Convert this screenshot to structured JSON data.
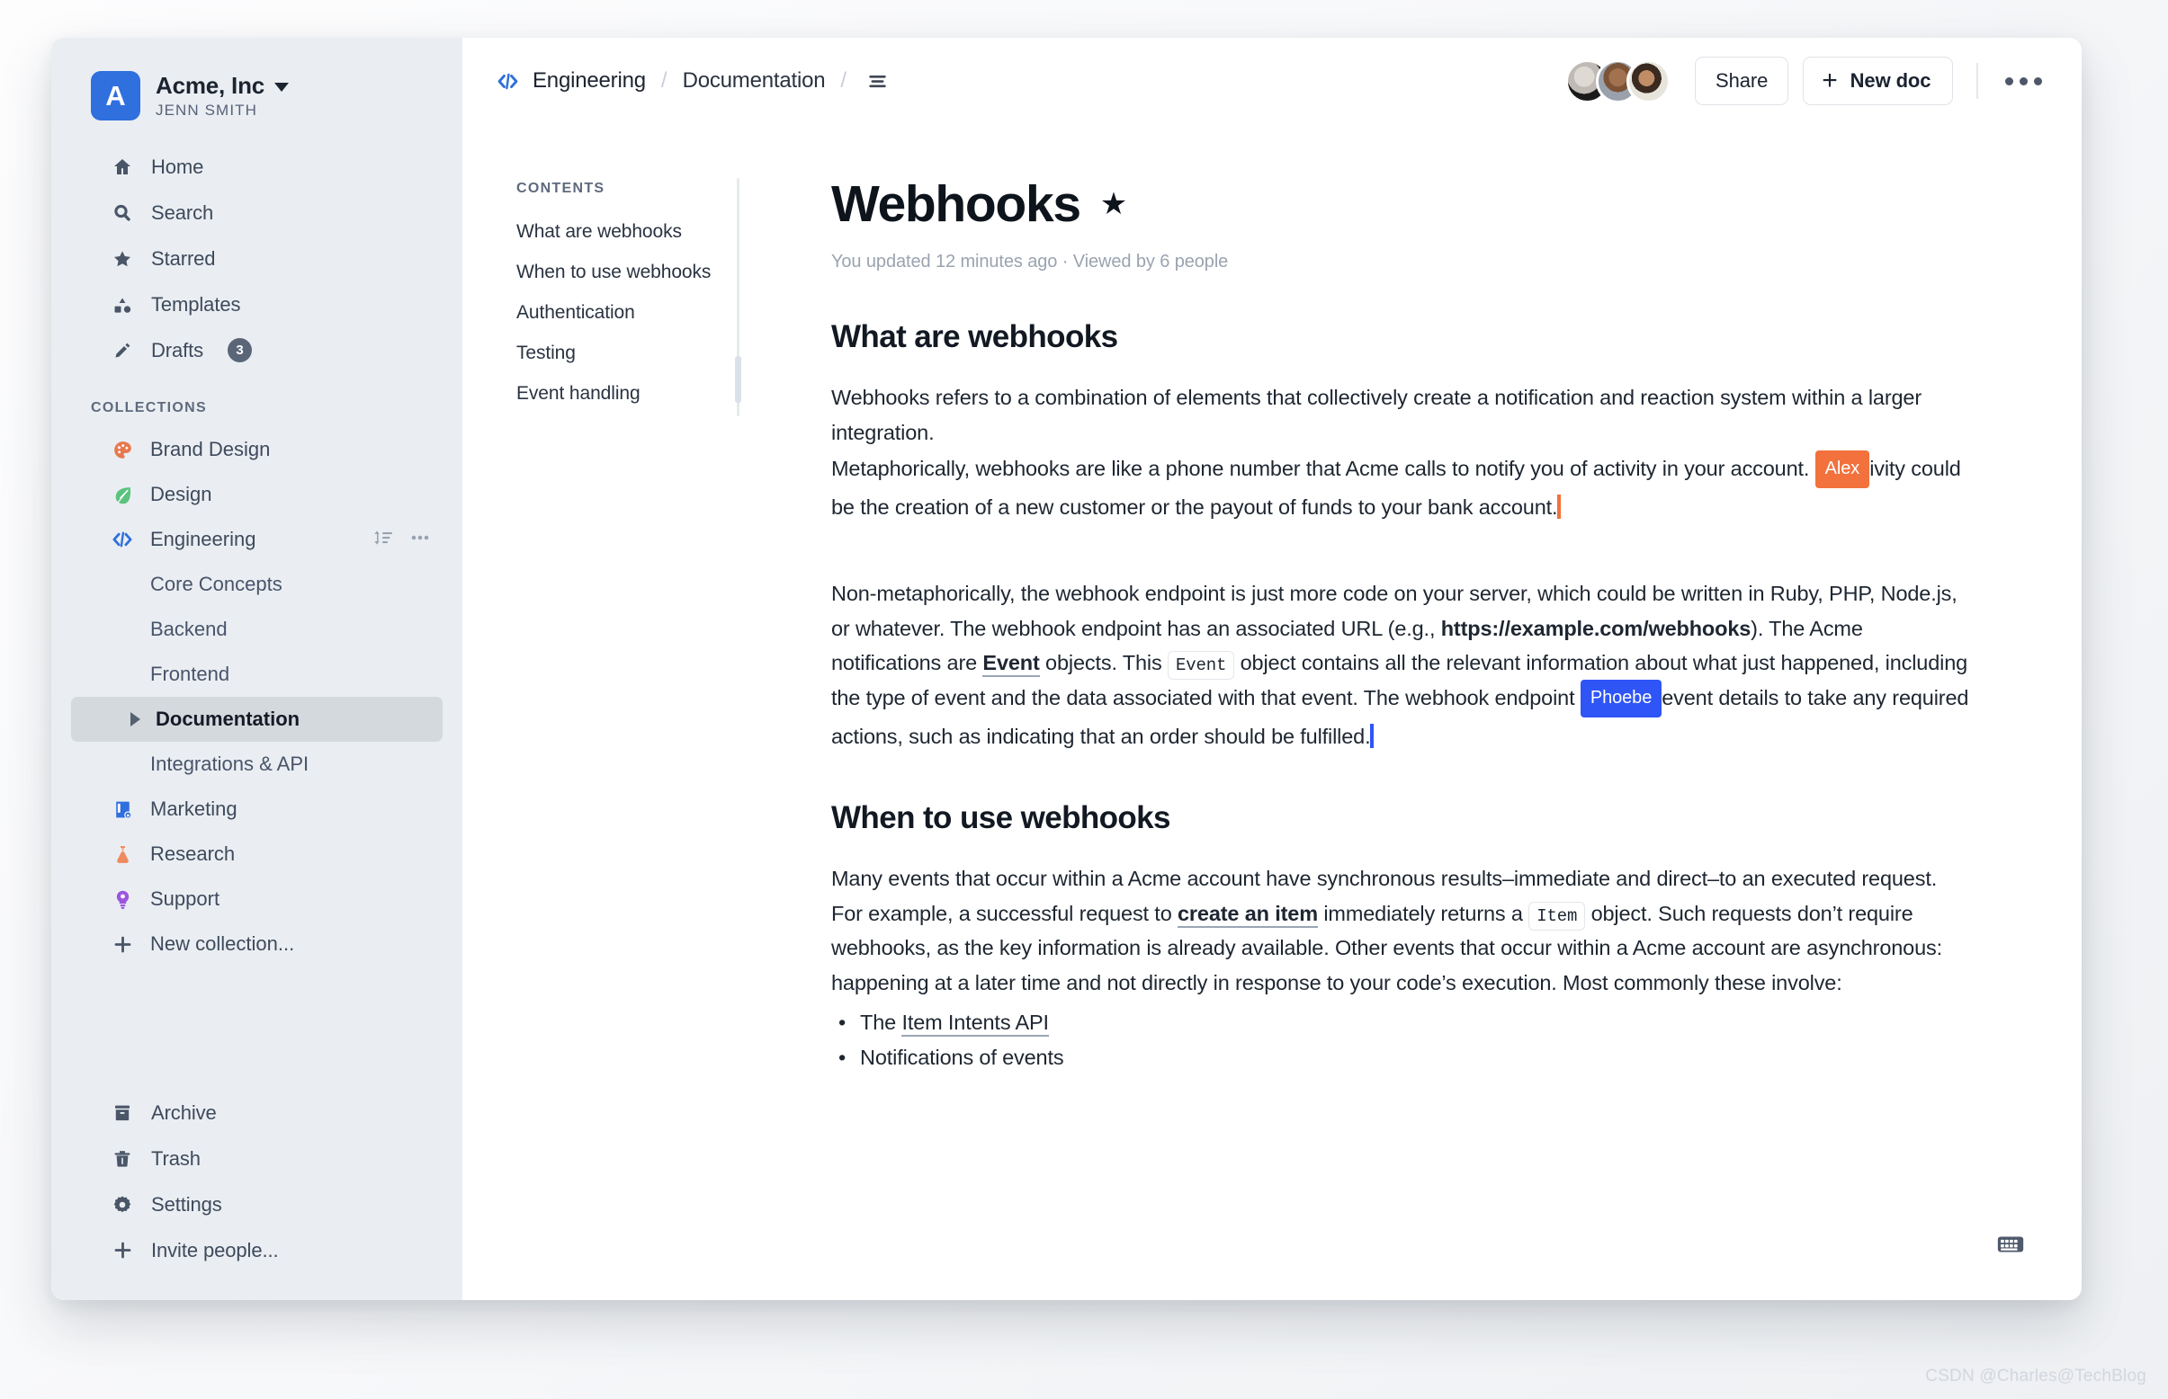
{
  "window": {
    "sidebar": {
      "team": {
        "avatar_letter": "A",
        "name": "Acme, Inc",
        "user": "JENN SMITH",
        "caret_icon": "chevron-down-icon"
      },
      "nav": [
        {
          "label": "Home",
          "icon": "home-icon"
        },
        {
          "label": "Search",
          "icon": "search-icon"
        },
        {
          "label": "Starred",
          "icon": "star-icon"
        },
        {
          "label": "Templates",
          "icon": "templates-icon"
        },
        {
          "label": "Drafts",
          "icon": "pencil-icon",
          "badge": "3"
        }
      ],
      "collections_header": "COLLECTIONS",
      "collections": [
        {
          "label": "Brand Design",
          "icon": "palette-icon",
          "color": "#e8784d"
        },
        {
          "label": "Design",
          "icon": "leaf-icon",
          "color": "#5ac37d"
        },
        {
          "label": "Engineering",
          "icon": "code-icon",
          "color": "#2f6fde",
          "actions": [
            "sort-icon",
            "more-icon"
          ]
        }
      ],
      "engineering_children": [
        {
          "label": "Core Concepts",
          "active": false
        },
        {
          "label": "Backend",
          "active": false
        },
        {
          "label": "Frontend",
          "active": false
        },
        {
          "label": "Documentation",
          "active": true
        },
        {
          "label": "Integrations & API",
          "active": false
        }
      ],
      "collections_after": [
        {
          "label": "Marketing",
          "icon": "book-lock-icon",
          "color": "#2f6fde"
        },
        {
          "label": "Research",
          "icon": "flask-icon",
          "color": "#ef8a5f"
        },
        {
          "label": "Support",
          "icon": "lightbulb-icon",
          "color": "#9b55e0"
        }
      ],
      "new_collection": {
        "label": "New collection...",
        "icon": "plus-icon"
      },
      "bottom": [
        {
          "label": "Archive",
          "icon": "archive-icon"
        },
        {
          "label": "Trash",
          "icon": "trash-icon"
        },
        {
          "label": "Settings",
          "icon": "gear-icon"
        },
        {
          "label": "Invite people...",
          "icon": "plus-icon"
        }
      ]
    },
    "topbar": {
      "breadcrumb": {
        "collection_icon": "code-icon",
        "collection": "Engineering",
        "sep1": "/",
        "document": "Documentation",
        "sep2": "/",
        "menu_icon": "hamburger-icon"
      },
      "share_label": "Share",
      "new_doc_label": "New doc",
      "new_doc_icon": "plus-icon",
      "more_icon": "more-icon",
      "avatar_count": 3
    },
    "toc": {
      "title": "CONTENTS",
      "items": [
        "What are webhooks",
        "When to use webhooks",
        "Authentication",
        "Testing",
        "Event handling"
      ]
    },
    "doc": {
      "title": "Webhooks",
      "star_icon": "star-icon",
      "meta": "You updated 12 minutes ago · Viewed by 6 people",
      "section1": {
        "heading": "What are webhooks",
        "p1": "Webhooks refers to a combination of elements that collectively create a notification and reaction system within a larger integration.",
        "p2_a": "Metaphorically, webhooks are like a phone number that Acme calls to notify you of activity in your account.",
        "p2_cursor": "Alex",
        "p2_b": "ivity could be the creation of a new customer or the payout of funds to your bank account.",
        "p3_a": "Non-metaphorically, the webhook endpoint is just more code on your server, which could be written in Ruby, PHP, Node.js, or whatever. The webhook endpoint has an associated URL (e.g., ",
        "p3_url": "https://example.com/webhooks",
        "p3_b": "). The Acme notifications are ",
        "p3_link": "Event",
        "p3_c": " objects. This ",
        "p3_code": "Event",
        "p3_d": " object contains all the relevant information about what just happened, including the type of event and the data associated with that event. The webhook endpoint ",
        "p3_cursor": "Phoebe",
        "p3_e": "event details to take any required actions, such as indicating that an order should be fulfilled."
      },
      "section2": {
        "heading": "When to use webhooks",
        "p1_a": "Many events that occur within a Acme account have synchronous results–immediate and direct–to an executed request. For example, a successful request to ",
        "p1_link": "create an item",
        "p1_b": " immediately returns a ",
        "p1_code": "Item",
        "p1_c": " object. Such requests don’t require webhooks, as the key information is already available. Other events that occur within a Acme account are asynchronous: happening at a later time and not directly in response to your code’s execution. Most commonly these involve:",
        "bullets": [
          {
            "prefix": "The ",
            "link": "Item Intents API",
            "suffix": ""
          },
          {
            "prefix": "Notifications of events",
            "link": "",
            "suffix": ""
          }
        ]
      },
      "keyboard_icon": "keyboard-icon"
    }
  },
  "watermark": "CSDN @Charles@TechBlog"
}
